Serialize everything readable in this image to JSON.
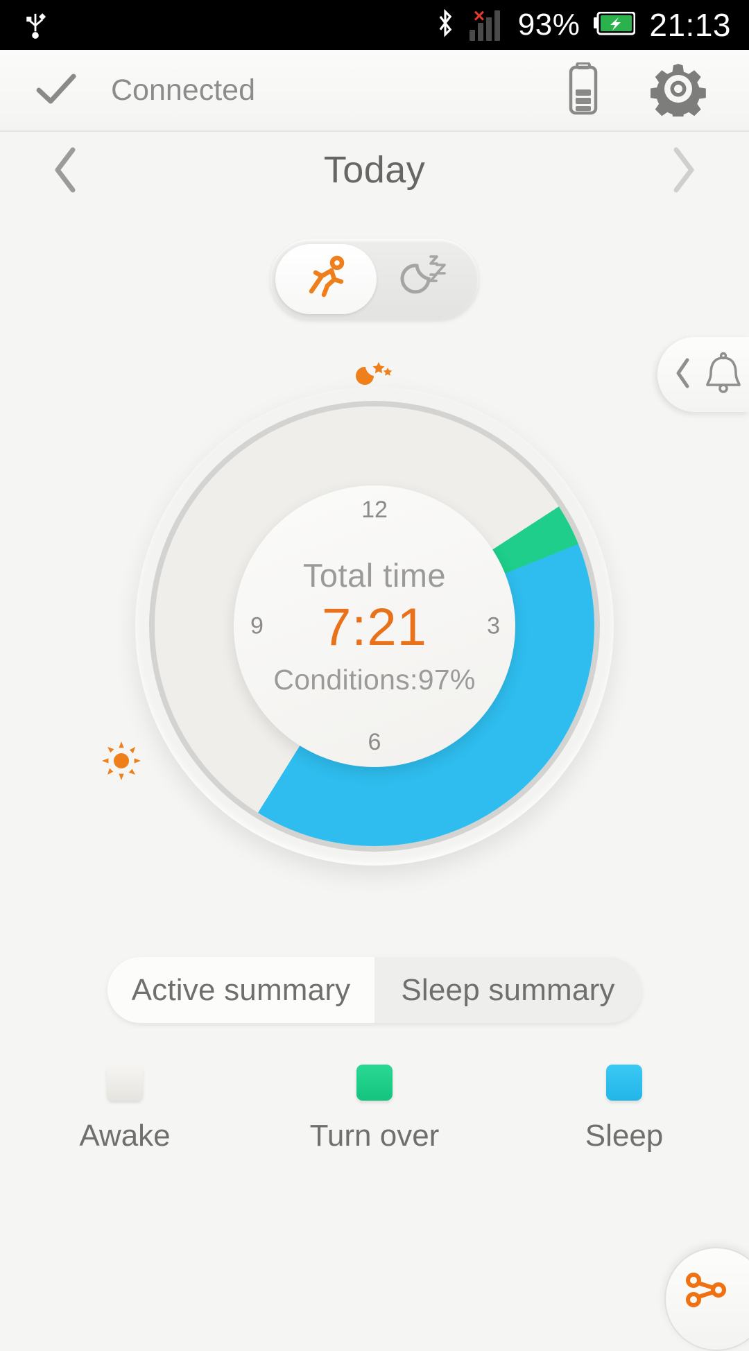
{
  "status_bar": {
    "usb_icon": "usb-icon",
    "bluetooth_icon": "bluetooth-icon",
    "signal_icon": "signal-bars-icon",
    "signal_error_mark": "×",
    "battery_percent": "93%",
    "battery_icon": "battery-charging-icon",
    "clock": "21:13"
  },
  "header": {
    "check_icon": "check-icon",
    "connection_status": "Connected",
    "battery_icon": "device-battery-icon",
    "settings_icon": "gear-icon"
  },
  "date_nav": {
    "prev_icon": "chevron-left-icon",
    "title": "Today",
    "next_icon": "chevron-right-icon"
  },
  "mode_toggle": {
    "active_option": "active",
    "options": [
      {
        "id": "active",
        "icon": "running-person-icon",
        "selected": true
      },
      {
        "id": "sleep",
        "icon": "moon-zzz-icon",
        "selected": false
      }
    ]
  },
  "bell_drawer": {
    "chevron_icon": "chevron-left-icon",
    "bell_icon": "bell-icon"
  },
  "ring": {
    "center_label": "Total time",
    "center_value": "7:21",
    "center_conditions": "Conditions:97%",
    "hour_marks": [
      "12",
      "3",
      "6",
      "9"
    ],
    "moon_marker_icon": "moon-stars-icon",
    "sun_marker_icon": "sun-icon"
  },
  "summary_tabs": [
    {
      "label": "Active summary",
      "selected": true
    },
    {
      "label": "Sleep summary",
      "selected": false
    }
  ],
  "legend": [
    {
      "label": "Awake",
      "color": "#ecebe7"
    },
    {
      "label": "Turn over",
      "color": "#1ece8a"
    },
    {
      "label": "Sleep",
      "color": "#2ebdee"
    }
  ],
  "share": {
    "icon": "share-icon"
  },
  "colors": {
    "accent_orange": "#e8711a",
    "sleep_blue": "#2ebdee",
    "turnover_green": "#1ece8a",
    "awake_gray": "#efeeea",
    "page_bg": "#f5f5f4"
  },
  "chart_data": {
    "type": "pie",
    "title": "Sleep ring (24h clock)",
    "categories": [
      "Awake",
      "Turn over",
      "Sleep"
    ],
    "colors": [
      "#efeeea",
      "#1ece8a",
      "#2ebdee"
    ],
    "series": [
      {
        "name": "Turn over",
        "start_deg": 57,
        "end_deg": 68,
        "color": "#1ece8a"
      },
      {
        "name": "Sleep",
        "start_deg": 68,
        "end_deg": 212,
        "color": "#2ebdee"
      },
      {
        "name": "Awake",
        "start_deg": 212,
        "end_deg": 57,
        "color": "#efeeea"
      }
    ],
    "center_total": "7:21",
    "center_conditions_pct": 97,
    "axis_ticks": [
      "12",
      "3",
      "6",
      "9"
    ]
  }
}
